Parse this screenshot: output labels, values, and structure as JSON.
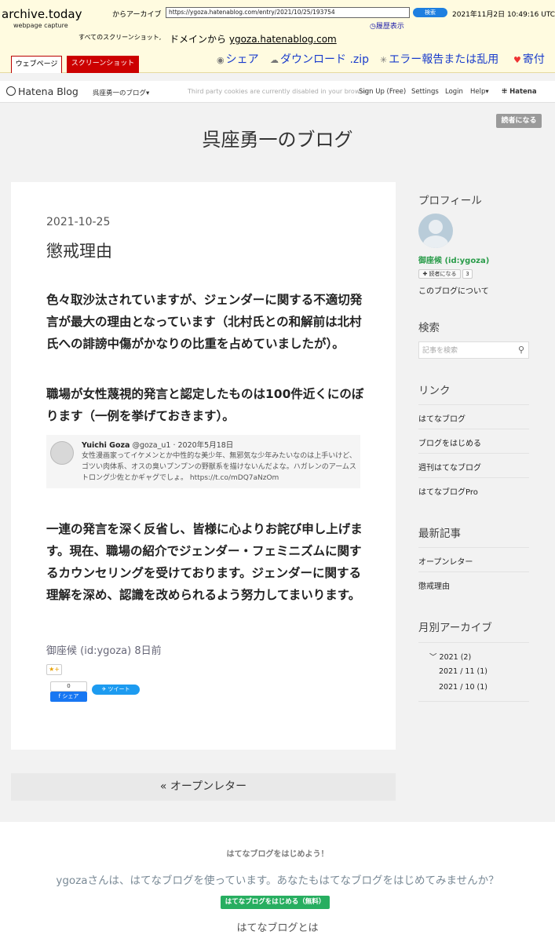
{
  "archive": {
    "logo": "archive.today",
    "subtitle": "webpage capture",
    "from_label": "からアーカイブ",
    "url": "https://ygoza.hatenablog.com/entry/2021/10/25/193754",
    "search_label": "検索",
    "datetime": "2021年11月2日 10:49:16 UTC",
    "history_label": "履歴表示",
    "all_screens_label": "すべてのスクリーンショット,",
    "domain_prefix": "ドメインから",
    "domain": "ygoza.hatenablog.com",
    "tabs": [
      "ウェブページ",
      "スクリーンショット"
    ],
    "actions": {
      "share": "シェア",
      "download": "ダウンロード .zip",
      "report": "エラー報告または乱用",
      "donate": "寄付"
    }
  },
  "nav": {
    "logo": "Hatena Blog",
    "blog_menu": "呉座勇一のブログ▾",
    "cookie_notice": "Third party cookies are currently disabled in your browser",
    "signup": "Sign Up (Free)",
    "settings": "Settings",
    "login": "Login",
    "help": "Help▾",
    "hatena": "Hatena"
  },
  "blog": {
    "subscribe_label": "読者になる",
    "title": "呉座勇一のブログ"
  },
  "post": {
    "date": "2021-10-25",
    "title": "懲戒理由",
    "para1": "色々取沙汰されていますが、ジェンダーに関する不適切発言が最大の理由となっています（北村氏との和解前は北村氏への誹謗中傷がかなりの比重を占めていましたが）。",
    "para2": "職場が女性蔑視的発言と認定したものは100件近くにのぼります（一例を挙げておきます）。",
    "tweet": {
      "name": "Yuichi Goza",
      "handle": "@goza_u1 · 2020年5月18日",
      "text": "女性漫画家ってイケメンとか中性的な美少年、無邪気な少年みたいなのは上手いけど、ゴツい肉体系、オスの臭いプンプンの野獣系を描けないんだよな。ハガレンのアームストロング少佐とかギャグでしょ。 https://t.co/mDQ7aNzOm"
    },
    "para3": "一連の発言を深く反省し、皆様に心よりお詫び申し上げます。現在、職場の紹介でジェンダー・フェミニズムに関するカウンセリングを受けております。ジェンダーに関する理解を深め、認識を改められるよう努力してまいります。",
    "author_line": "御座候 (id:ygoza) 8日前",
    "star_label": "★+",
    "fb_count": "0",
    "fb_share": "f シェア",
    "tweet_button": "ツイート"
  },
  "pager": {
    "prev": "« オープンレター"
  },
  "sidebar": {
    "profile_heading": "プロフィール",
    "profile_name": "御座候 (id:ygoza)",
    "subscribe_label": "✚ 読者になる",
    "subscriber_count": "3",
    "about_link": "このブログについて",
    "search_heading": "検索",
    "search_placeholder": "記事を検索",
    "links_heading": "リンク",
    "links": [
      "はてなブログ",
      "ブログをはじめる",
      "週刊はてなブログ",
      "はてなブログPro"
    ],
    "recent_heading": "最新記事",
    "recent": [
      "オープンレター",
      "懲戒理由"
    ],
    "archive_heading": "月別アーカイブ",
    "archive_year": "﹀ 2021 (2)",
    "archive_months": [
      "2021 / 11 (1)",
      "2021 / 10 (1)"
    ]
  },
  "footer": {
    "heading": "はてなブログをはじめよう！",
    "message": "ygozaさんは、はてなブログを使っています。あなたもはてなブログをはじめてみませんか？",
    "button": "はてなブログをはじめる（無料）",
    "about": "はてなブログとは"
  }
}
